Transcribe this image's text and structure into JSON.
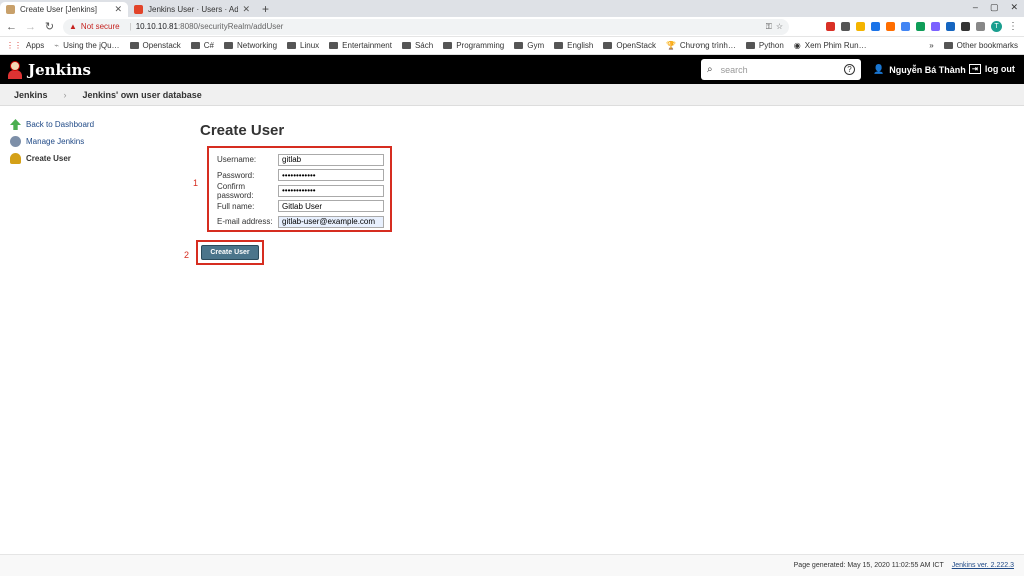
{
  "browser": {
    "tabs": [
      {
        "title": "Create User [Jenkins]",
        "close": "✕",
        "active": true
      },
      {
        "title": "Jenkins User · Users · Adm",
        "close": "✕",
        "active": false
      }
    ],
    "new_tab": "+",
    "window_controls": [
      "–",
      "▢",
      "✕"
    ],
    "url": {
      "warning": "Not secure",
      "host": "10.10.10.81",
      "rest": ":8080/securityRealm/addUser"
    },
    "profile_initial": "T",
    "bookmarks": [
      "Apps",
      "Using the jQu…",
      "Openstack",
      "C#",
      "Networking",
      "Linux",
      "Entertainment",
      "Sách",
      "Programming",
      "Gym",
      "English",
      "OpenStack",
      "Chương trình…",
      "Python",
      "Xem Phim Run…"
    ],
    "bookmarks_more": "»",
    "other_bookmarks": "Other bookmarks"
  },
  "jenkins": {
    "brand": "Jenkins",
    "search_placeholder": "search",
    "help": "?",
    "user": "Nguyễn Bá Thành",
    "logout": "log out"
  },
  "breadcrumb": [
    "Jenkins",
    "Jenkins' own user database"
  ],
  "breadcrumb_sep": "›",
  "sidebar": [
    {
      "label": "Back to Dashboard",
      "icon": "up-arrow-icon",
      "color": "#4caf50"
    },
    {
      "label": "Manage Jenkins",
      "icon": "gear-icon",
      "color": "#7d8fa8"
    },
    {
      "label": "Create User",
      "icon": "user-add-icon",
      "color": "#d4a017"
    }
  ],
  "page_title": "Create User",
  "form": {
    "fields": [
      {
        "label": "Username:",
        "value": "gitlab"
      },
      {
        "label": "Password:",
        "value": "••••••••••••"
      },
      {
        "label": "Confirm password:",
        "value": "••••••••••••"
      },
      {
        "label": "Full name:",
        "value": "Gitlab User"
      },
      {
        "label": "E-mail address:",
        "value": "gitlab-user@example.com"
      }
    ],
    "submit": "Create User"
  },
  "annotations": [
    "1",
    "2"
  ],
  "footer": {
    "generated": "Page generated: May 15, 2020 11:02:55 AM ICT",
    "version": "Jenkins ver. 2.222.3"
  },
  "colors": {
    "annotation": "#d62d20",
    "button": "#4b758b",
    "header": "#000000"
  }
}
